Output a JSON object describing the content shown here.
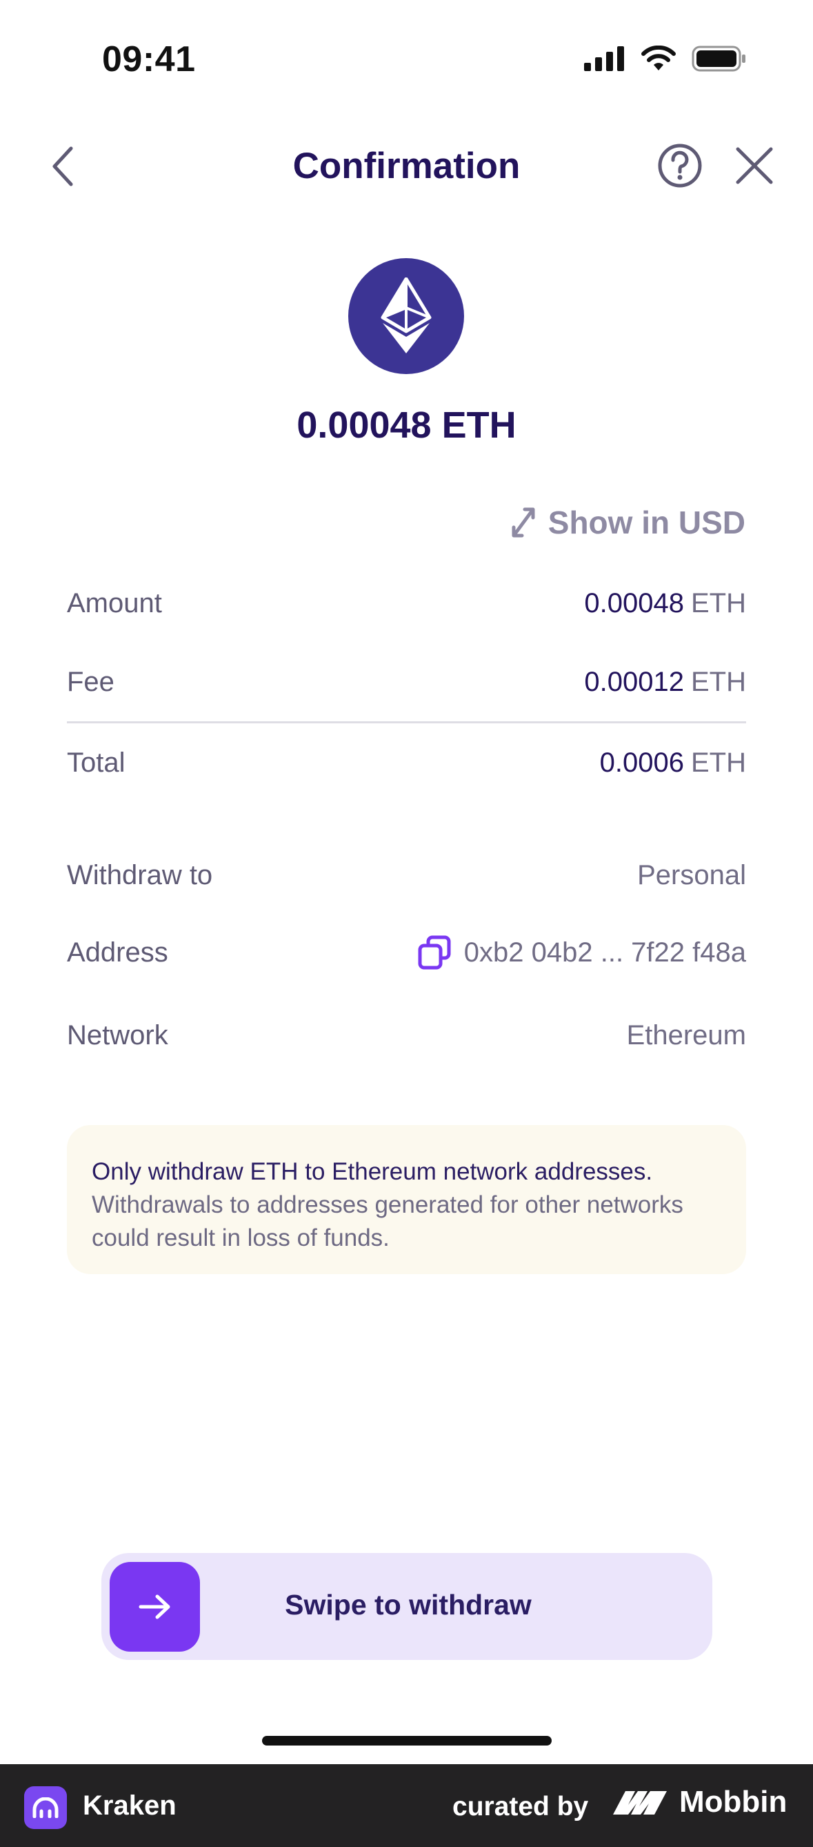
{
  "status_bar": {
    "time": "09:41"
  },
  "nav": {
    "title": "Confirmation"
  },
  "asset": {
    "amount_display": "0.00048 ETH"
  },
  "show_usd_label": "Show in USD",
  "summary": {
    "amount": {
      "label": "Amount",
      "value": "0.00048",
      "unit": "ETH"
    },
    "fee": {
      "label": "Fee",
      "value": "0.00012",
      "unit": "ETH"
    },
    "total": {
      "label": "Total",
      "value": "0.0006",
      "unit": "ETH"
    }
  },
  "details": {
    "withdraw_to": {
      "label": "Withdraw to",
      "value": "Personal"
    },
    "address": {
      "label": "Address",
      "value": "0xb2 04b2 ... 7f22 f48a"
    },
    "network": {
      "label": "Network",
      "value": "Ethereum"
    }
  },
  "warning": {
    "strong": "Only withdraw ETH to Ethereum network addresses.",
    "text": "Withdrawals to addresses generated for other networks could result in loss of funds."
  },
  "swipe": {
    "label": "Swipe to withdraw"
  },
  "footer": {
    "app_name": "Kraken",
    "curated_by": "curated by",
    "brand": "Mobbin"
  },
  "colors": {
    "accent": "#7a37f2",
    "title": "#22135c",
    "coin": "#3c3494",
    "warning_bg": "#fcf9ee"
  }
}
